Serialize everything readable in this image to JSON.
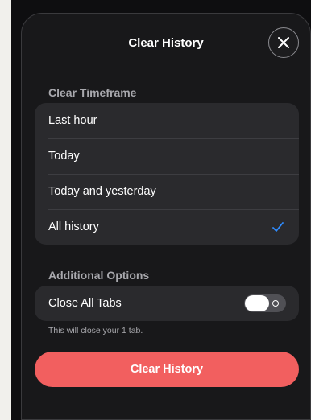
{
  "dialog": {
    "title": "Clear History",
    "close_icon": "close-icon"
  },
  "timeframe": {
    "header": "Clear Timeframe",
    "options": [
      {
        "label": "Last hour",
        "selected": false
      },
      {
        "label": "Today",
        "selected": false
      },
      {
        "label": "Today and yesterday",
        "selected": false
      },
      {
        "label": "All history",
        "selected": true
      }
    ],
    "check_icon": "checkmark-icon",
    "check_color": "#2f8cff"
  },
  "additional": {
    "header": "Additional Options",
    "close_all_tabs_label": "Close All Tabs",
    "close_all_tabs_on": false,
    "note": "This will close your 1 tab."
  },
  "action": {
    "label": "Clear History",
    "color": "#f25f5f"
  }
}
